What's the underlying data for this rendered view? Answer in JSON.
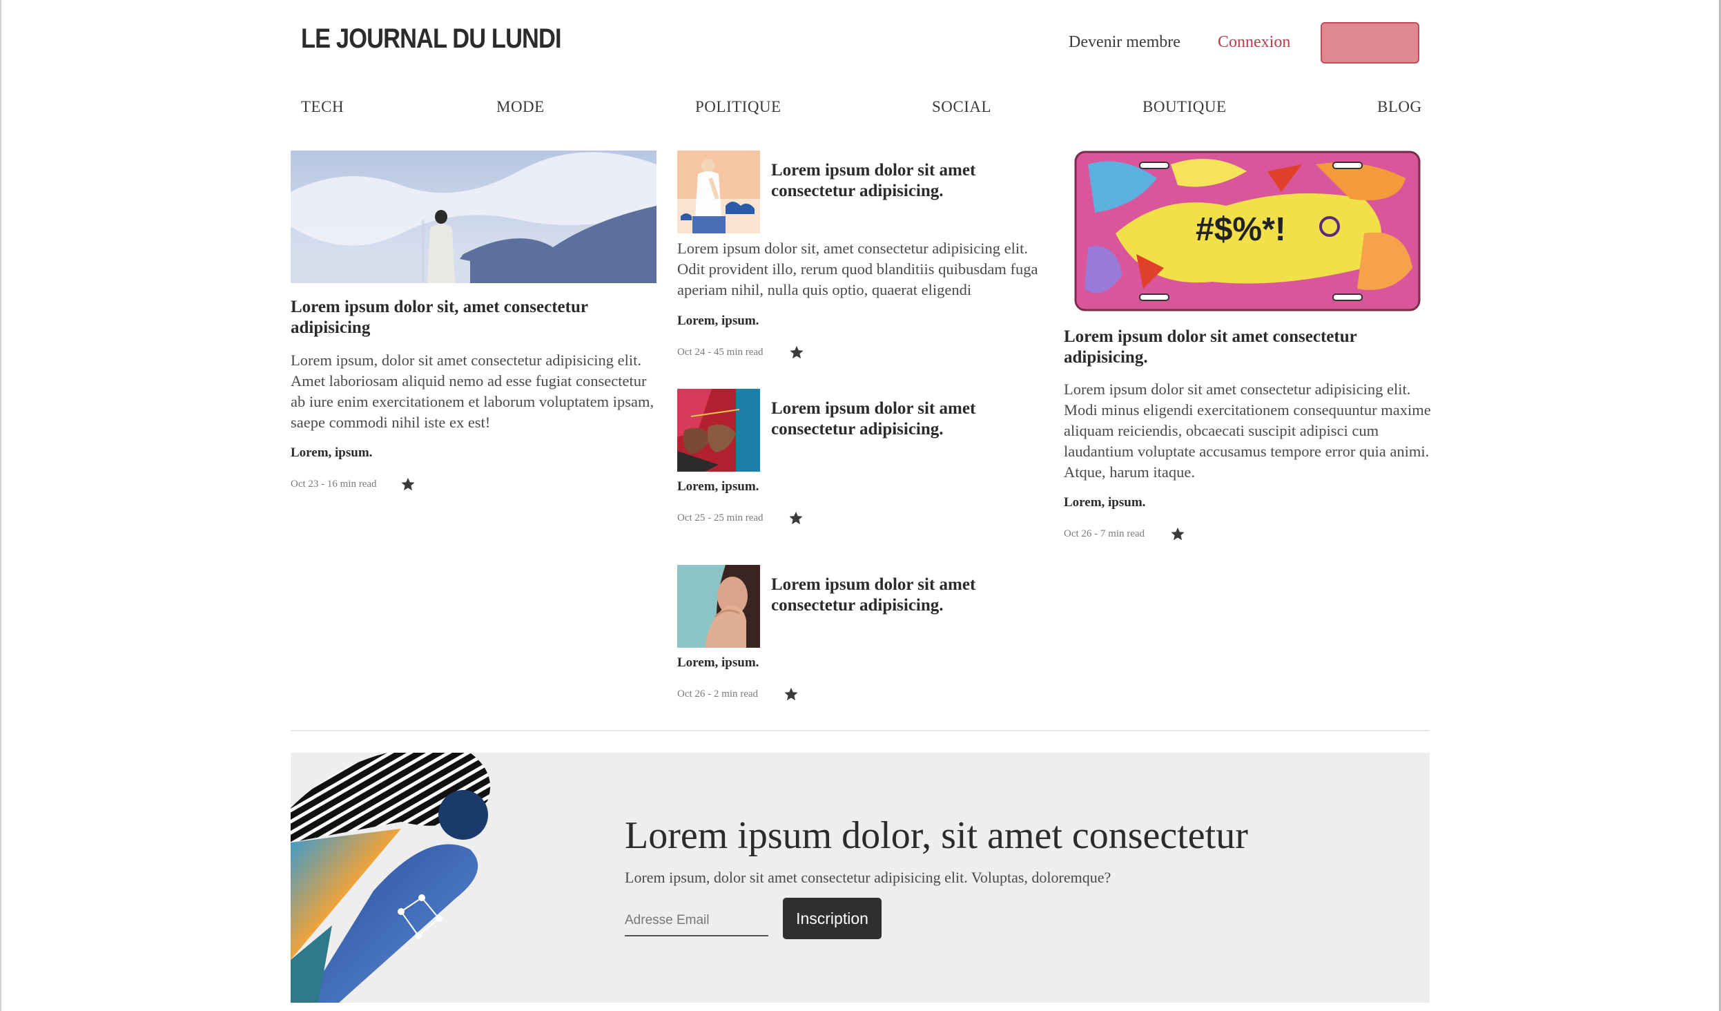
{
  "header": {
    "logo": "LE JOURNAL DU LUNDI",
    "member_link": "Devenir membre",
    "login_link": "Connexion",
    "accent_color": "#df8890",
    "login_color": "#c3394c"
  },
  "nav": [
    "TECH",
    "MODE",
    "POLITIQUE",
    "SOCIAL",
    "BOUTIQUE",
    "BLOG"
  ],
  "articles": {
    "left": {
      "title": "Lorem ipsum dolor sit, amet consectetur adipisicing",
      "excerpt": "Lorem ipsum, dolor sit amet consectetur adipisicing elit. Amet laboriosam aliquid nemo ad esse fugiat consectetur ab iure enim exercitationem et laborum voluptatem ipsam, saepe commodi nihil iste ex est!",
      "author": "Lorem, ipsum.",
      "meta": "Oct 23 - 16 min read",
      "image": "person-on-snowy-mountain"
    },
    "mid1": {
      "title": "Lorem ipsum dolor sit amet consectetur adipisicing.",
      "excerpt": "Lorem ipsum dolor sit, amet consectetur adipisicing elit. Odit provident illo, rerum quod blanditiis quibusdam fuga aperiam nihil, nulla quis optio, quaerat eligendi",
      "author": "Lorem, ipsum.",
      "meta": "Oct 24 - 45 min read",
      "image": "illustration-man-with-clouds"
    },
    "mid2": {
      "title": "Lorem ipsum dolor sit amet consectetur adipisicing.",
      "author": "Lorem, ipsum.",
      "meta": "Oct 25 - 25 min read",
      "image": "hands-knitting"
    },
    "mid3": {
      "title": "Lorem ipsum dolor sit amet consectetur adipisicing.",
      "author": "Lorem, ipsum.",
      "meta": "Oct 26 - 2 min read",
      "image": "woman-covering-mouth"
    },
    "right": {
      "title": "Lorem ipsum dolor sit amet consectetur adipisicing.",
      "excerpt": "Lorem ipsum dolor sit amet consectetur adipisicing elit. Modi minus eligendi exercitationem consequuntur maxime aliquam reiciendis, obcaecati suscipit adipisci cum laudantium voluptate accusamus tempore error quia animi. Atque, harum itaque.",
      "author": "Lorem, ipsum.",
      "meta": "Oct 26 - 7 min read",
      "image": "comic-license-plate",
      "image_text": "#$%*!"
    }
  },
  "newsletter": {
    "title": "Lorem ipsum dolor, sit amet consectetur",
    "subtitle": "Lorem ipsum, dolor sit amet consectetur adipisicing elit. Voluptas, doloremque?",
    "email_placeholder": "Adresse Email",
    "button_label": "Inscription",
    "art": "abstract-collage-shapes"
  },
  "icons": {
    "bookmark": "star-icon"
  }
}
